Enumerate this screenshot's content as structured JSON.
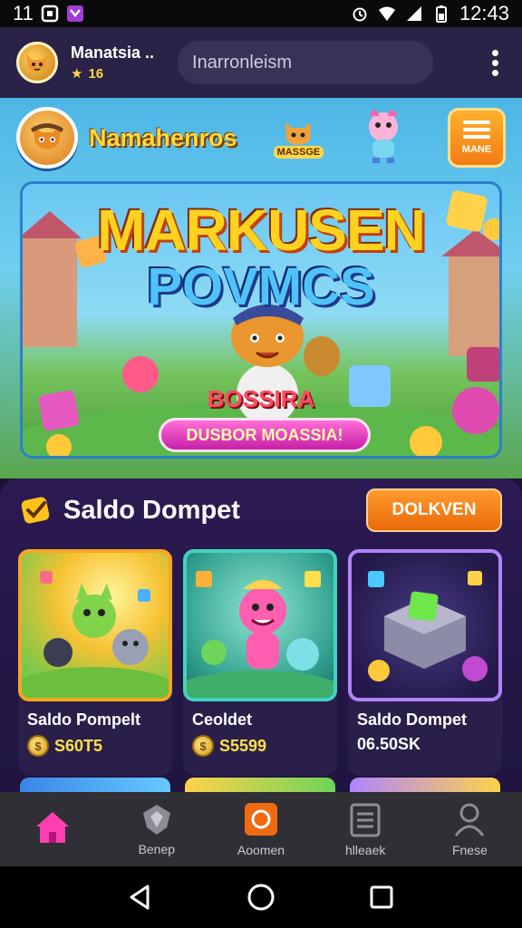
{
  "status_bar": {
    "left_number": "11",
    "time": "12:43"
  },
  "header": {
    "username": "Manatsia ..",
    "points": "16",
    "search_placeholder": "Inarronleism"
  },
  "brand": {
    "name": "Namahenros",
    "mascot_label": "MASSGE",
    "menu_label": "MANE"
  },
  "banner": {
    "title_line1": "MARKUSEN",
    "title_line2": "POVMCS",
    "subtitle": "BOSSIRA",
    "cta": "DUSBOR MOASSIA!"
  },
  "wallet": {
    "title": "Saldo Dompet",
    "action_button": "DOLKVEN",
    "cards": [
      {
        "label": "Saldo Pompelt",
        "value": "S60T5"
      },
      {
        "label": "Ceoldet",
        "value": "S5599"
      },
      {
        "label": "Saldo Dompet",
        "value": "06.50SK"
      }
    ]
  },
  "bottom_nav": {
    "items": [
      {
        "label": "",
        "icon": "home-icon",
        "active": true
      },
      {
        "label": "Benep",
        "icon": "shield-icon",
        "active": false
      },
      {
        "label": "Aoomen",
        "icon": "camera-icon",
        "active": false
      },
      {
        "label": "hlleaek",
        "icon": "list-icon",
        "active": false
      },
      {
        "label": "Fnese",
        "icon": "user-icon",
        "active": false
      }
    ]
  },
  "colors": {
    "accent_orange": "#f37b12",
    "accent_pink": "#ff4fb8",
    "panel_purple": "#2c1a52",
    "appbar": "#2b2247"
  }
}
